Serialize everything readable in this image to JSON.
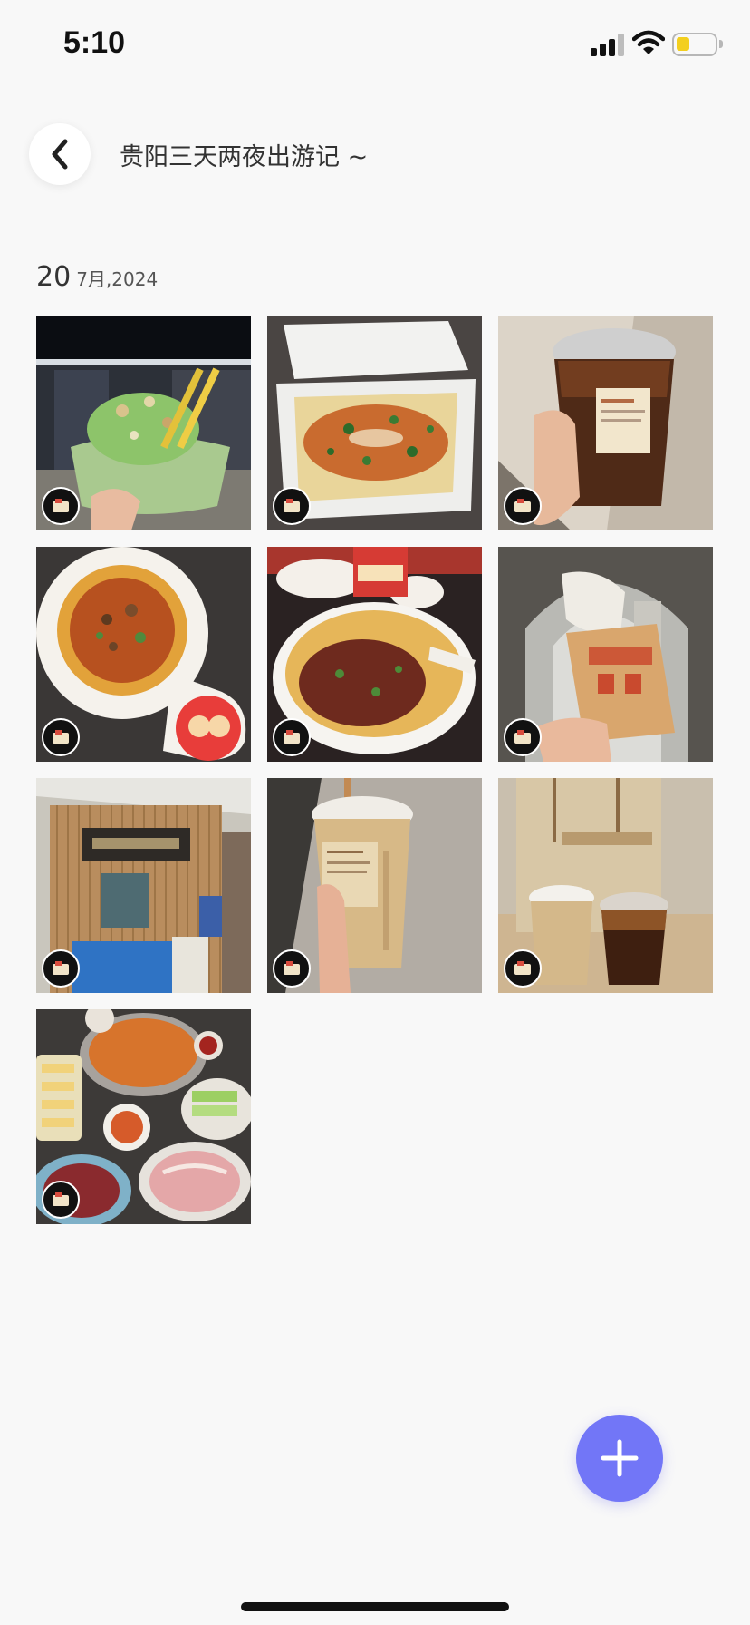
{
  "status_bar": {
    "time": "5:10"
  },
  "header": {
    "title": "贵阳三天两夜出游记 ~"
  },
  "section": {
    "day": "20",
    "month_year": "7月,2024"
  },
  "photos": [
    {
      "name": "photo-shaved-ice"
    },
    {
      "name": "photo-tofu-box"
    },
    {
      "name": "photo-iced-tea"
    },
    {
      "name": "photo-spicy-noodles"
    },
    {
      "name": "photo-noodle-bowl"
    },
    {
      "name": "photo-crispy-snack"
    },
    {
      "name": "photo-beef-noodle-shop"
    },
    {
      "name": "photo-milk-tea-cup"
    },
    {
      "name": "photo-two-drinks"
    },
    {
      "name": "photo-hotpot"
    }
  ],
  "icons": {
    "back": "chevron-left-icon",
    "add": "plus-icon",
    "badge": "tag-icon"
  },
  "colors": {
    "accent": "#7276f7",
    "background": "#f8f8f8",
    "battery": "#f3cf1f"
  }
}
